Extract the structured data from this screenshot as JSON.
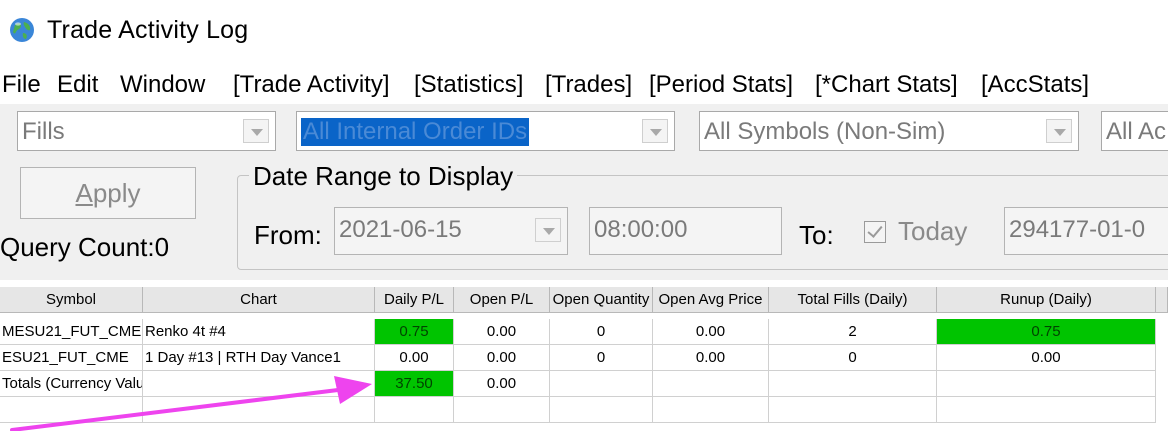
{
  "window": {
    "title": "Trade Activity Log"
  },
  "menu": [
    "File",
    "Edit",
    "Window",
    "[Trade Activity]",
    "[Statistics]",
    "[Trades]",
    "[Period Stats]",
    "[*Chart Stats]",
    "[AccStats]"
  ],
  "filters": {
    "type": "Fills",
    "order_ids": "All Internal Order IDs",
    "symbols": "All Symbols (Non-Sim)",
    "accounts": "All Ac"
  },
  "apply_button": {
    "pre": "",
    "underlined": "A",
    "rest": "pply"
  },
  "query_count": "Query Count:0",
  "date_range": {
    "title": "Date Range to Display",
    "from_label": "From:",
    "from_date": "2021-06-15",
    "from_time": "08:00:00",
    "to_label": "To:",
    "today_label": "Today",
    "to_date": "294177-01-0"
  },
  "table": {
    "headers": [
      "Symbol",
      "Chart",
      "Daily P/L",
      "Open P/L",
      "Open Quantity",
      "Open Avg Price",
      "Total Fills (Daily)",
      "Runup (Daily)"
    ],
    "rows": [
      [
        "MESU21_FUT_CME",
        "Renko 4t  #4",
        "0.75",
        "0.00",
        "0",
        "0.00",
        "2",
        "0.75"
      ],
      [
        "ESU21_FUT_CME",
        "1 Day  #13 | RTH Day Vance1",
        "0.00",
        "0.00",
        "0",
        "0.00",
        "0",
        "0.00"
      ],
      [
        "Totals (Currency Value)",
        "",
        "37.50",
        "0.00",
        "",
        "",
        "",
        ""
      ]
    ]
  },
  "colors": {
    "highlight_green": "#00c400",
    "annotation_arrow": "#ee44ee",
    "selection_blue": "#0a64c8"
  },
  "icons": {
    "app": "globe-icon",
    "annotation": "arrow-annotation"
  }
}
